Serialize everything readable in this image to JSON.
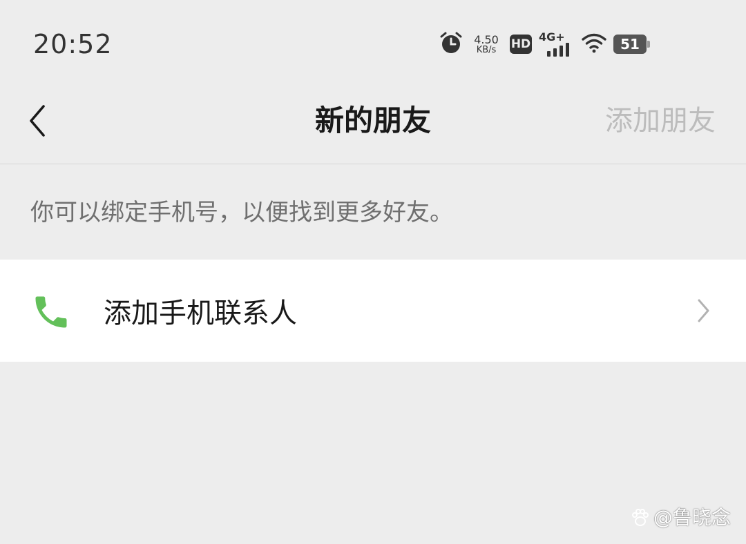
{
  "status_bar": {
    "time": "20:52",
    "net_speed_value": "4.50",
    "net_speed_unit": "KB/s",
    "hd_label": "HD",
    "network_type": "4G+",
    "battery_level": "51",
    "icons": [
      "alarm-icon",
      "hd-icon",
      "signal-icon",
      "wifi-icon",
      "battery-icon"
    ]
  },
  "nav": {
    "back_icon": "chevron-left-icon",
    "title": "新的朋友",
    "action_label": "添加朋友"
  },
  "hint": "你可以绑定手机号，以便找到更多好友。",
  "list": {
    "items": [
      {
        "label": "添加手机联系人",
        "icon": "phone-icon",
        "icon_color": "#63c05a"
      }
    ]
  },
  "watermark": {
    "text": "@鲁晓念",
    "icon": "paw-icon"
  },
  "colors": {
    "background": "#ededed",
    "cell_background": "#ffffff",
    "accent_green": "#63c05a",
    "title_text": "#191919",
    "hint_text": "#6f6f6f",
    "disabled_action": "#bcbcbc"
  }
}
